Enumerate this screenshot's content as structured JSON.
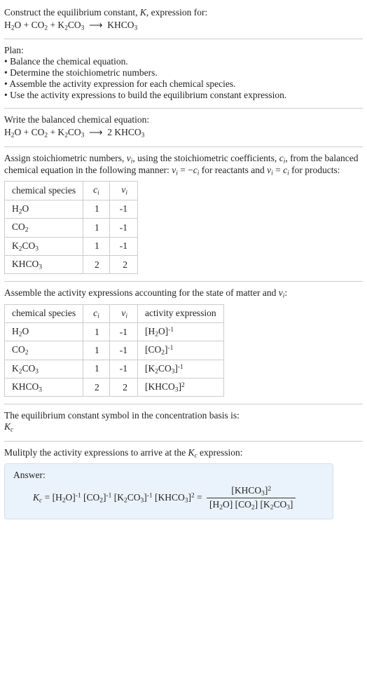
{
  "intro": {
    "line1": "Construct the equilibrium constant, K, expression for:",
    "equation": "H₂O + CO₂ + K₂CO₃ ⟶ KHCO₃"
  },
  "plan": {
    "heading": "Plan:",
    "items": [
      "• Balance the chemical equation.",
      "• Determine the stoichiometric numbers.",
      "• Assemble the activity expression for each chemical species.",
      "• Use the activity expressions to build the equilibrium constant expression."
    ]
  },
  "balanced": {
    "heading": "Write the balanced chemical equation:",
    "equation": "H₂O + CO₂ + K₂CO₃ ⟶ 2 KHCO₃"
  },
  "stoich": {
    "text_a": "Assign stoichiometric numbers, νᵢ, using the stoichiometric coefficients, cᵢ, from the balanced chemical equation in the following manner: νᵢ = −cᵢ for reactants and νᵢ = cᵢ for products:",
    "headers": [
      "chemical species",
      "cᵢ",
      "νᵢ"
    ],
    "rows": [
      {
        "sp": "H₂O",
        "c": "1",
        "v": "-1"
      },
      {
        "sp": "CO₂",
        "c": "1",
        "v": "-1"
      },
      {
        "sp": "K₂CO₃",
        "c": "1",
        "v": "-1"
      },
      {
        "sp": "KHCO₃",
        "c": "2",
        "v": "2"
      }
    ]
  },
  "activity": {
    "heading": "Assemble the activity expressions accounting for the state of matter and νᵢ:",
    "headers": [
      "chemical species",
      "cᵢ",
      "νᵢ",
      "activity expression"
    ],
    "rows": [
      {
        "sp": "H₂O",
        "c": "1",
        "v": "-1",
        "ae_base": "[H₂O]",
        "ae_exp": "-1"
      },
      {
        "sp": "CO₂",
        "c": "1",
        "v": "-1",
        "ae_base": "[CO₂]",
        "ae_exp": "-1"
      },
      {
        "sp": "K₂CO₃",
        "c": "1",
        "v": "-1",
        "ae_base": "[K₂CO₃]",
        "ae_exp": "-1"
      },
      {
        "sp": "KHCO₃",
        "c": "2",
        "v": "2",
        "ae_base": "[KHCO₃]",
        "ae_exp": "2"
      }
    ]
  },
  "symbol": {
    "line1": "The equilibrium constant symbol in the concentration basis is:",
    "line2": "K_c"
  },
  "multiply": {
    "heading": "Mulitply the activity expressions to arrive at the K_c expression:"
  },
  "answer": {
    "label": "Answer:",
    "lhs": "K_c = ",
    "terms": [
      {
        "base": "[H₂O]",
        "exp": "-1"
      },
      {
        "base": "[CO₂]",
        "exp": "-1"
      },
      {
        "base": "[K₂CO₃]",
        "exp": "-1"
      },
      {
        "base": "[KHCO₃]",
        "exp": "2"
      }
    ],
    "eq_sign": " = ",
    "frac_num_base": "[KHCO₃]",
    "frac_num_exp": "2",
    "frac_den": "[H₂O] [CO₂] [K₂CO₃]"
  },
  "chart_data": {
    "type": "table",
    "tables": [
      {
        "title": "Stoichiometric numbers",
        "columns": [
          "chemical species",
          "c_i",
          "ν_i"
        ],
        "rows": [
          [
            "H2O",
            1,
            -1
          ],
          [
            "CO2",
            1,
            -1
          ],
          [
            "K2CO3",
            1,
            -1
          ],
          [
            "KHCO3",
            2,
            2
          ]
        ]
      },
      {
        "title": "Activity expressions",
        "columns": [
          "chemical species",
          "c_i",
          "ν_i",
          "activity expression"
        ],
        "rows": [
          [
            "H2O",
            1,
            -1,
            "[H2O]^-1"
          ],
          [
            "CO2",
            1,
            -1,
            "[CO2]^-1"
          ],
          [
            "K2CO3",
            1,
            -1,
            "[K2CO3]^-1"
          ],
          [
            "KHCO3",
            2,
            2,
            "[KHCO3]^2"
          ]
        ]
      }
    ]
  }
}
